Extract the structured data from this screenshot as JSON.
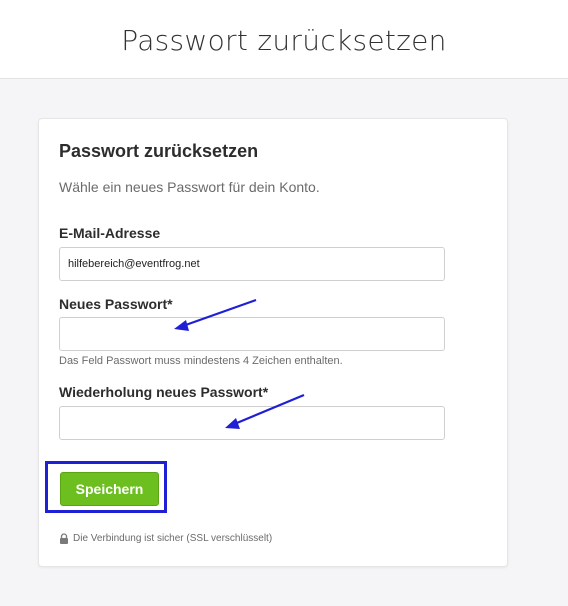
{
  "header": {
    "title": "Passwort zurücksetzen"
  },
  "form": {
    "title": "Passwort zurücksetzen",
    "subtitle": "Wähle ein neues Passwort für dein Konto.",
    "email": {
      "label": "E-Mail-Adresse",
      "value": "hilfebereich@eventfrog.net"
    },
    "new_password": {
      "label": "Neues Passwort*",
      "value": "",
      "hint": "Das Feld Passwort muss mindestens 4 Zeichen enthalten."
    },
    "repeat_password": {
      "label": "Wiederholung neues Passwort*",
      "value": ""
    },
    "save_label": "Speichern",
    "secure_note": "Die Verbindung ist sicher (SSL verschlüsselt)"
  },
  "colors": {
    "accent_green": "#6cbf1e",
    "annotation_blue": "#1f1fd6"
  },
  "icons": {
    "secure": "lock-icon"
  }
}
